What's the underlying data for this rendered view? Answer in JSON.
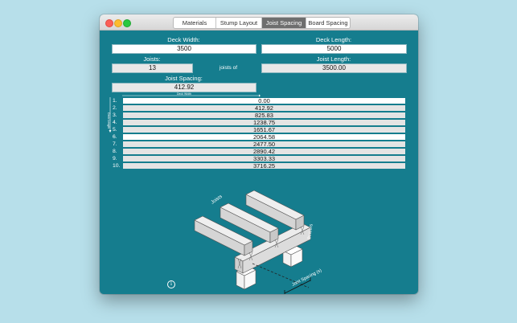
{
  "tabs": [
    {
      "label": "Materials",
      "active": false
    },
    {
      "label": "Stump Layout",
      "active": false
    },
    {
      "label": "Joist Spacing",
      "active": true
    },
    {
      "label": "Board Spacing",
      "active": false
    }
  ],
  "form": {
    "deck_width_label": "Deck Width:",
    "deck_width_value": "3500",
    "deck_length_label": "Deck Length:",
    "deck_length_value": "5000",
    "joists_label": "Joists:",
    "joists_value": "13",
    "joists_of_text": "joists of",
    "joist_length_label": "Joist Length:",
    "joist_length_value": "3500.00",
    "joist_spacing_label": "Joist Spacing:",
    "joist_spacing_value": "412.92"
  },
  "table_hint": {
    "deck_width": "Deck Width",
    "deck_length": "Deck Length"
  },
  "spacing_rows": [
    {
      "num": "1.",
      "value": "0.00"
    },
    {
      "num": "2.",
      "value": "412.92"
    },
    {
      "num": "3.",
      "value": "825.83"
    },
    {
      "num": "4.",
      "value": "1238.75"
    },
    {
      "num": "5.",
      "value": "1651.67"
    },
    {
      "num": "6.",
      "value": "2064.58"
    },
    {
      "num": "7.",
      "value": "2477.50"
    },
    {
      "num": "8.",
      "value": "2890.42"
    },
    {
      "num": "9.",
      "value": "3303.33"
    },
    {
      "num": "10.",
      "value": "3716.25"
    }
  ],
  "diagram": {
    "joists_label": "Joists",
    "bearers_label": "Bearers",
    "spacing_label": "Joist Spacing (s)"
  },
  "info_glyph": "i",
  "colors": {
    "background": "#b7dfea",
    "window": "#157d8e",
    "active_tab": "#6e6e6e"
  }
}
